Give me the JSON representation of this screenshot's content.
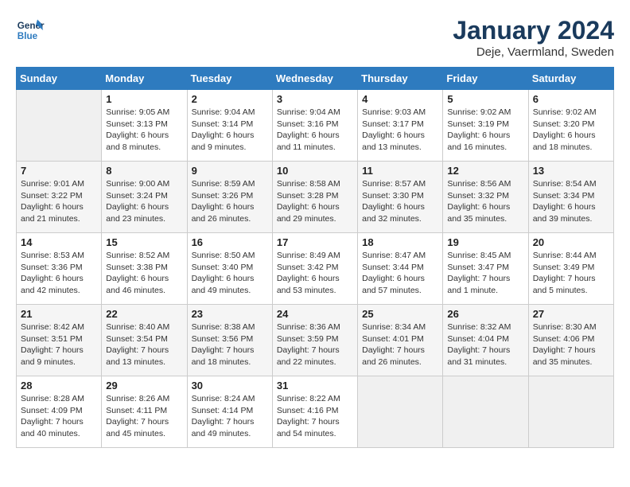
{
  "logo": {
    "line1": "General",
    "line2": "Blue"
  },
  "title": "January 2024",
  "location": "Deje, Vaermland, Sweden",
  "days_of_week": [
    "Sunday",
    "Monday",
    "Tuesday",
    "Wednesday",
    "Thursday",
    "Friday",
    "Saturday"
  ],
  "weeks": [
    [
      {
        "day": "",
        "info": ""
      },
      {
        "day": "1",
        "info": "Sunrise: 9:05 AM\nSunset: 3:13 PM\nDaylight: 6 hours\nand 8 minutes."
      },
      {
        "day": "2",
        "info": "Sunrise: 9:04 AM\nSunset: 3:14 PM\nDaylight: 6 hours\nand 9 minutes."
      },
      {
        "day": "3",
        "info": "Sunrise: 9:04 AM\nSunset: 3:16 PM\nDaylight: 6 hours\nand 11 minutes."
      },
      {
        "day": "4",
        "info": "Sunrise: 9:03 AM\nSunset: 3:17 PM\nDaylight: 6 hours\nand 13 minutes."
      },
      {
        "day": "5",
        "info": "Sunrise: 9:02 AM\nSunset: 3:19 PM\nDaylight: 6 hours\nand 16 minutes."
      },
      {
        "day": "6",
        "info": "Sunrise: 9:02 AM\nSunset: 3:20 PM\nDaylight: 6 hours\nand 18 minutes."
      }
    ],
    [
      {
        "day": "7",
        "info": "Sunrise: 9:01 AM\nSunset: 3:22 PM\nDaylight: 6 hours\nand 21 minutes."
      },
      {
        "day": "8",
        "info": "Sunrise: 9:00 AM\nSunset: 3:24 PM\nDaylight: 6 hours\nand 23 minutes."
      },
      {
        "day": "9",
        "info": "Sunrise: 8:59 AM\nSunset: 3:26 PM\nDaylight: 6 hours\nand 26 minutes."
      },
      {
        "day": "10",
        "info": "Sunrise: 8:58 AM\nSunset: 3:28 PM\nDaylight: 6 hours\nand 29 minutes."
      },
      {
        "day": "11",
        "info": "Sunrise: 8:57 AM\nSunset: 3:30 PM\nDaylight: 6 hours\nand 32 minutes."
      },
      {
        "day": "12",
        "info": "Sunrise: 8:56 AM\nSunset: 3:32 PM\nDaylight: 6 hours\nand 35 minutes."
      },
      {
        "day": "13",
        "info": "Sunrise: 8:54 AM\nSunset: 3:34 PM\nDaylight: 6 hours\nand 39 minutes."
      }
    ],
    [
      {
        "day": "14",
        "info": "Sunrise: 8:53 AM\nSunset: 3:36 PM\nDaylight: 6 hours\nand 42 minutes."
      },
      {
        "day": "15",
        "info": "Sunrise: 8:52 AM\nSunset: 3:38 PM\nDaylight: 6 hours\nand 46 minutes."
      },
      {
        "day": "16",
        "info": "Sunrise: 8:50 AM\nSunset: 3:40 PM\nDaylight: 6 hours\nand 49 minutes."
      },
      {
        "day": "17",
        "info": "Sunrise: 8:49 AM\nSunset: 3:42 PM\nDaylight: 6 hours\nand 53 minutes."
      },
      {
        "day": "18",
        "info": "Sunrise: 8:47 AM\nSunset: 3:44 PM\nDaylight: 6 hours\nand 57 minutes."
      },
      {
        "day": "19",
        "info": "Sunrise: 8:45 AM\nSunset: 3:47 PM\nDaylight: 7 hours\nand 1 minute."
      },
      {
        "day": "20",
        "info": "Sunrise: 8:44 AM\nSunset: 3:49 PM\nDaylight: 7 hours\nand 5 minutes."
      }
    ],
    [
      {
        "day": "21",
        "info": "Sunrise: 8:42 AM\nSunset: 3:51 PM\nDaylight: 7 hours\nand 9 minutes."
      },
      {
        "day": "22",
        "info": "Sunrise: 8:40 AM\nSunset: 3:54 PM\nDaylight: 7 hours\nand 13 minutes."
      },
      {
        "day": "23",
        "info": "Sunrise: 8:38 AM\nSunset: 3:56 PM\nDaylight: 7 hours\nand 18 minutes."
      },
      {
        "day": "24",
        "info": "Sunrise: 8:36 AM\nSunset: 3:59 PM\nDaylight: 7 hours\nand 22 minutes."
      },
      {
        "day": "25",
        "info": "Sunrise: 8:34 AM\nSunset: 4:01 PM\nDaylight: 7 hours\nand 26 minutes."
      },
      {
        "day": "26",
        "info": "Sunrise: 8:32 AM\nSunset: 4:04 PM\nDaylight: 7 hours\nand 31 minutes."
      },
      {
        "day": "27",
        "info": "Sunrise: 8:30 AM\nSunset: 4:06 PM\nDaylight: 7 hours\nand 35 minutes."
      }
    ],
    [
      {
        "day": "28",
        "info": "Sunrise: 8:28 AM\nSunset: 4:09 PM\nDaylight: 7 hours\nand 40 minutes."
      },
      {
        "day": "29",
        "info": "Sunrise: 8:26 AM\nSunset: 4:11 PM\nDaylight: 7 hours\nand 45 minutes."
      },
      {
        "day": "30",
        "info": "Sunrise: 8:24 AM\nSunset: 4:14 PM\nDaylight: 7 hours\nand 49 minutes."
      },
      {
        "day": "31",
        "info": "Sunrise: 8:22 AM\nSunset: 4:16 PM\nDaylight: 7 hours\nand 54 minutes."
      },
      {
        "day": "",
        "info": ""
      },
      {
        "day": "",
        "info": ""
      },
      {
        "day": "",
        "info": ""
      }
    ]
  ]
}
